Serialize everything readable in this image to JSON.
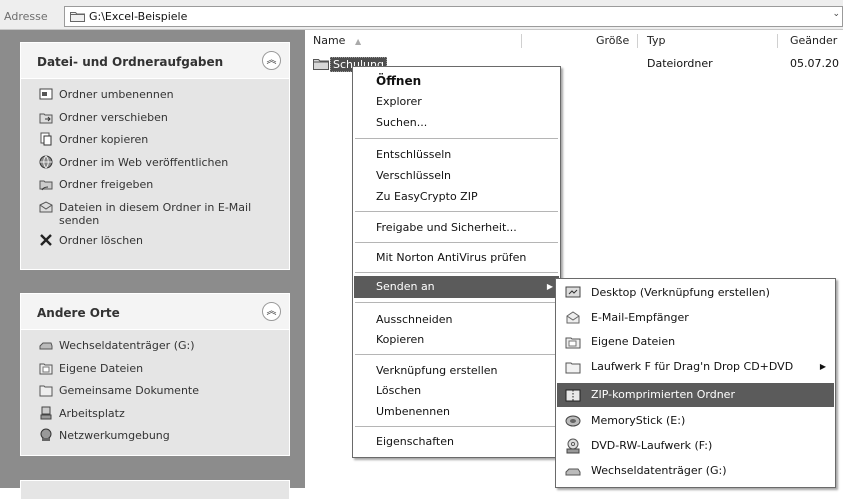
{
  "address_bar": {
    "label": "Adresse",
    "path": "G:\\Excel-Beispiele",
    "dropdown_glyph": "⌄"
  },
  "task_pane": {
    "file_tasks": {
      "title": "Datei- und Ordneraufgaben",
      "collapse_glyph": "︽",
      "items": [
        {
          "label": "Ordner umbenennen",
          "icon": "rename-icon"
        },
        {
          "label": "Ordner verschieben",
          "icon": "move-icon"
        },
        {
          "label": "Ordner kopieren",
          "icon": "copy-icon"
        },
        {
          "label": "Ordner im Web veröffentlichen",
          "icon": "web-publish-icon"
        },
        {
          "label": "Ordner freigeben",
          "icon": "share-folder-icon"
        },
        {
          "label": "Dateien in diesem Ordner in E-Mail senden",
          "icon": "email-icon"
        },
        {
          "label": "Ordner löschen",
          "icon": "delete-icon"
        }
      ]
    },
    "other_places": {
      "title": "Andere Orte",
      "collapse_glyph": "︽",
      "items": [
        {
          "label": "Wechseldatenträger (G:)",
          "icon": "removable-drive-icon"
        },
        {
          "label": "Eigene Dateien",
          "icon": "my-documents-icon"
        },
        {
          "label": "Gemeinsame Dokumente",
          "icon": "shared-documents-icon"
        },
        {
          "label": "Arbeitsplatz",
          "icon": "my-computer-icon"
        },
        {
          "label": "Netzwerkumgebung",
          "icon": "network-icon"
        }
      ]
    }
  },
  "file_list": {
    "columns": {
      "name": "Name",
      "size": "Größe",
      "type": "Typ",
      "modified": "Geänder"
    },
    "sort_glyph": "▲",
    "rows": [
      {
        "name": "Schulung",
        "type": "Dateiordner",
        "modified": "05.07.20"
      }
    ]
  },
  "context_menu": {
    "items": [
      {
        "label": "Öffnen"
      },
      {
        "label": "Explorer"
      },
      {
        "label": "Suchen..."
      },
      {
        "label": "Entschlüsseln"
      },
      {
        "label": "Verschlüsseln"
      },
      {
        "label": "Zu EasyCrypto ZIP"
      },
      {
        "label": "Freigabe und Sicherheit..."
      },
      {
        "label": "Mit Norton AntiVirus prüfen"
      },
      {
        "label": "Senden an"
      },
      {
        "label": "Ausschneiden"
      },
      {
        "label": "Kopieren"
      },
      {
        "label": "Verknüpfung erstellen"
      },
      {
        "label": "Löschen"
      },
      {
        "label": "Umbenennen"
      },
      {
        "label": "Eigenschaften"
      }
    ],
    "submenu_arrow": "▶"
  },
  "send_to_menu": {
    "items": [
      {
        "label": "Desktop (Verknüpfung erstellen)",
        "icon": "desktop-icon"
      },
      {
        "label": "E-Mail-Empfänger",
        "icon": "mail-recipient-icon"
      },
      {
        "label": "Eigene Dateien",
        "icon": "my-documents-icon"
      },
      {
        "label": "Laufwerk F für Drag'n Drop CD+DVD",
        "icon": "drive-folder-icon"
      },
      {
        "label": "ZIP-komprimierten Ordner",
        "icon": "zip-folder-icon"
      },
      {
        "label": "MemoryStick (E:)",
        "icon": "memory-stick-icon"
      },
      {
        "label": "DVD-RW-Laufwerk (F:)",
        "icon": "dvd-drive-icon"
      },
      {
        "label": "Wechseldatenträger (G:)",
        "icon": "removable-drive-icon"
      }
    ],
    "submenu_arrow": "▶"
  },
  "colors": {
    "pane_bg": "#8c8c8c",
    "panel_bg": "#e5e5e5",
    "highlight": "#5b5b5b"
  }
}
